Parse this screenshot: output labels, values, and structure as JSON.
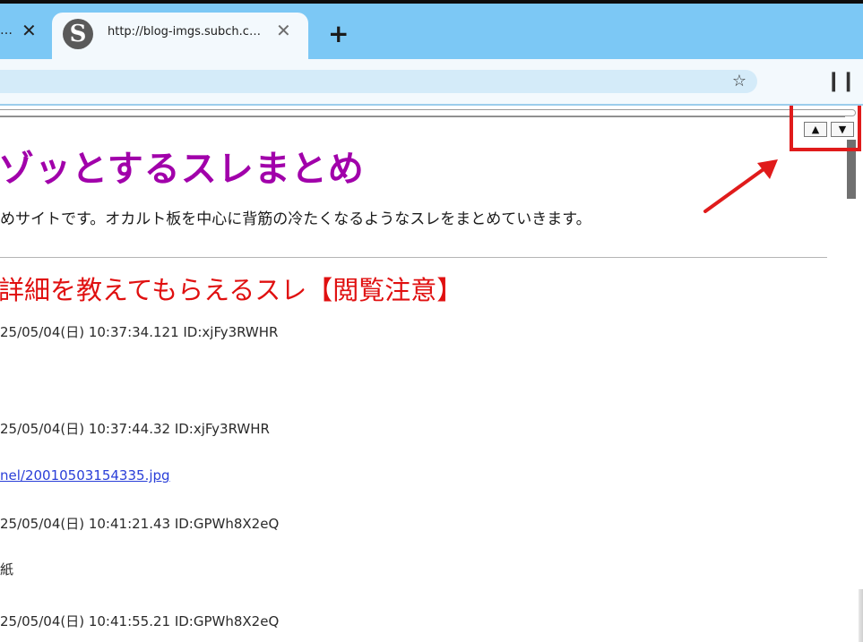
{
  "browser": {
    "prev_tab": {
      "ellipsis": "…",
      "close": "✕"
    },
    "active_tab": {
      "favicon": "S",
      "title": "http://blog-imgs.subch.c…",
      "close": "✕"
    },
    "new_tab": "+",
    "address_bar": {
      "value": "",
      "bookmark_icon": "☆"
    },
    "extension_icon": "❙❙"
  },
  "page": {
    "blog_title": "ゾッとするスレまとめ",
    "blog_description": "めサイトです。オカルト板を中心に背筋の冷たくなるようなスレをまとめていきます。",
    "thread_title": "詳細を教えてもらえるスレ【閲覧注意】",
    "posts": [
      "25/05/04(日) 10:37:34.121 ID:xjFy3RWHR",
      "25/05/04(日) 10:37:44.32 ID:xjFy3RWHR",
      "25/05/04(日) 10:41:21.43 ID:GPWh8X2eQ",
      "25/05/04(日) 10:41:55.21 ID:GPWh8X2eQ"
    ],
    "link_text": "nel/20010503154335.jpg",
    "body_text": "紙"
  },
  "scroll_controls": {
    "up": "▲",
    "down": "▼"
  },
  "colors": {
    "title_purple": "#a100aa",
    "thread_red": "#e01010",
    "link_blue": "#2a3fd8",
    "annotation_red": "#e01b1b",
    "tabstrip_blue": "#7cc8f5"
  }
}
